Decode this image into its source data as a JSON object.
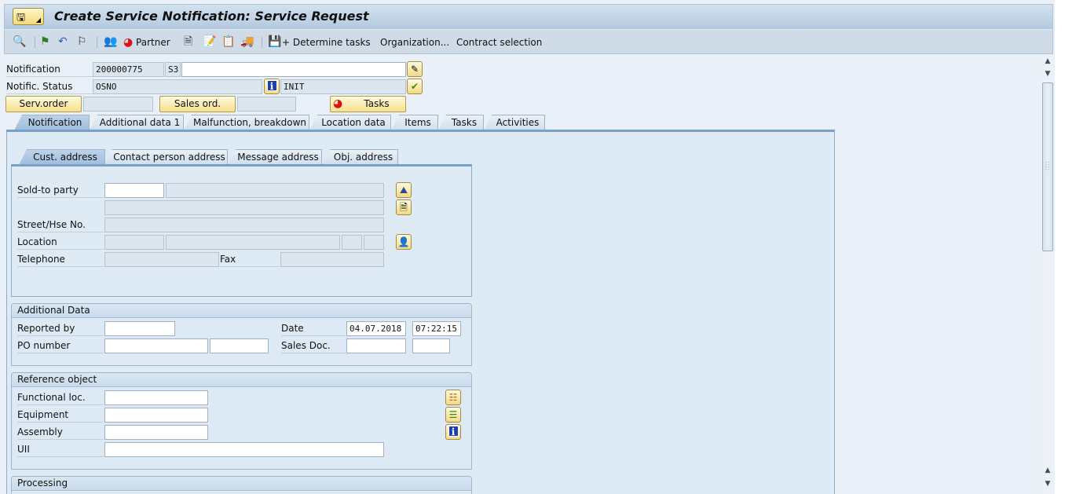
{
  "window": {
    "title": "Create Service Notification: Service Request"
  },
  "toolbar": {
    "items": [
      {
        "icon": "display-object-icon"
      },
      {
        "icon": "green-flag-icon"
      },
      {
        "icon": "back-arrows-icon"
      },
      {
        "icon": "checkered-flag-icon"
      },
      {
        "icon": "partners-icon"
      },
      {
        "icon": "partner-lifebuoy-icon",
        "label": "Partner"
      },
      {
        "icon": "document-icon"
      },
      {
        "icon": "notepad-icon"
      },
      {
        "icon": "catalog-icon"
      },
      {
        "icon": "truck-icon"
      },
      {
        "icon": "save-icon"
      },
      {
        "label": "+ Determine tasks"
      },
      {
        "label": "Organization..."
      },
      {
        "label": "Contract selection"
      }
    ]
  },
  "header": {
    "notification_label": "Notification",
    "notification_number": "200000775",
    "notification_type": "S3",
    "notification_description": "",
    "status_label": "Notific. Status",
    "status_system": "OSNO",
    "status_user": "INIT",
    "serv_order_button": "Serv.order",
    "serv_order_value": "",
    "sales_ord_button": "Sales ord.",
    "sales_ord_value": "",
    "tasks_button": "Tasks"
  },
  "tabs": [
    {
      "label": "Notification",
      "active": true
    },
    {
      "label": "Additional data 1",
      "active": false
    },
    {
      "label": "Malfunction, breakdown",
      "active": false
    },
    {
      "label": "Location data",
      "active": false
    },
    {
      "label": "Items",
      "active": false
    },
    {
      "label": "Tasks",
      "active": false
    },
    {
      "label": "Activities",
      "active": false
    }
  ],
  "address_tabs": [
    {
      "label": "Cust. address",
      "active": true
    },
    {
      "label": "Contact person address",
      "active": false
    },
    {
      "label": "Message address",
      "active": false
    },
    {
      "label": "Obj. address",
      "active": false
    }
  ],
  "cust_address": {
    "sold_to_label": "Sold-to party",
    "sold_to_value": "",
    "sold_to_name": "",
    "name2": "",
    "street_label": "Street/Hse No.",
    "street_value": "",
    "location_label": "Location",
    "postal_code": "",
    "city": "",
    "country": "",
    "region": "",
    "telephone_label": "Telephone",
    "telephone_value": "",
    "fax_label": "Fax",
    "fax_value": ""
  },
  "additional_data": {
    "title": "Additional Data",
    "reported_by_label": "Reported by",
    "reported_by_value": "",
    "po_number_label": "PO number",
    "po_number_value": "",
    "po_date_value": "",
    "date_label": "Date",
    "date_value": "04.07.2018",
    "time_value": "07:22:15",
    "sales_doc_label": "Sales Doc.",
    "sales_doc_value": "",
    "sales_doc_item": ""
  },
  "reference_object": {
    "title": "Reference object",
    "functional_loc_label": "Functional loc.",
    "functional_loc_value": "",
    "equipment_label": "Equipment",
    "equipment_value": "",
    "assembly_label": "Assembly",
    "assembly_value": "",
    "uii_label": "UII",
    "uii_value": ""
  },
  "processing": {
    "title": "Processing"
  }
}
